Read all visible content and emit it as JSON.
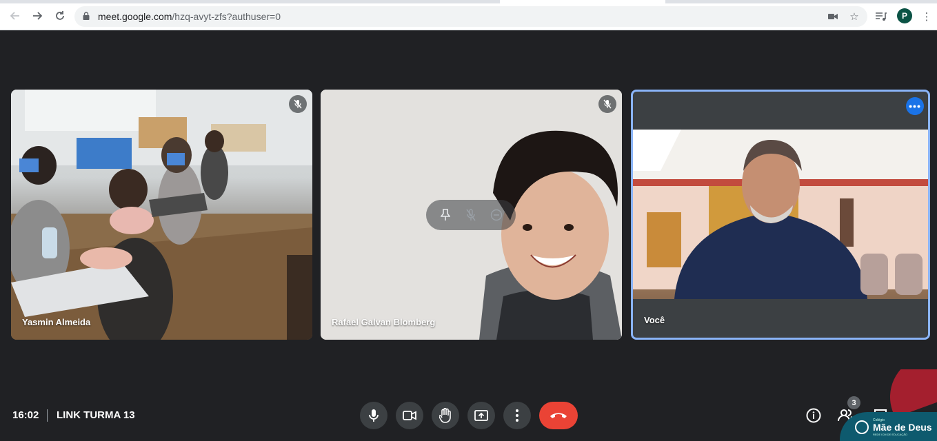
{
  "browser": {
    "url_host": "meet.google.com",
    "url_path": "/hzq-avyt-zfs?authuser=0",
    "profile_initial": "P"
  },
  "tiles": [
    {
      "name": "Yasmin Almeida",
      "muted": true
    },
    {
      "name": "Rafael Galvan Blomberg",
      "muted": true
    },
    {
      "name": "Você",
      "muted": false
    }
  ],
  "meeting": {
    "time": "16:02",
    "title": "LINK TURMA 13",
    "participant_count": "3"
  },
  "branding": {
    "small_top": "Colégio",
    "name": "Mãe de Deus",
    "sub": "REDE ICM DE EDUCAÇÃO"
  },
  "colors": {
    "background": "#202124",
    "hangup": "#ea4335",
    "active_border": "#8ab4f8",
    "more_button": "#1a73e8"
  }
}
